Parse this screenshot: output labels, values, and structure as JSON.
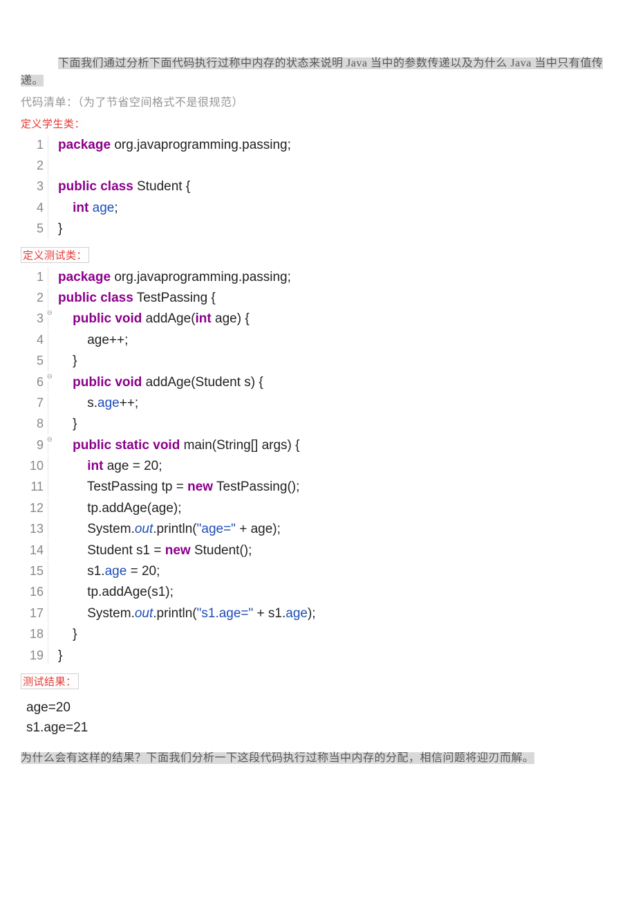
{
  "intro": "下面我们通过分析下面代码执行过称中内存的状态来说明 Java 当中的参数传递以及为什么 Java 当中只有值传递。",
  "note": "代码清单：（为了节省空间格式不是很规范）",
  "label_student": "定义学生类：",
  "label_test": "定义测试类：",
  "label_result": "测试结果：",
  "closing": "为什么会有这样的结果？下面我们分析一下这段代码执行过称当中内存的分配，相信问题将迎刃而解。",
  "student": {
    "l1": {
      "kw": "package",
      "rest": " org.javaprogramming.passing;"
    },
    "l3a": "public class",
    "l3b": " Student {",
    "l4a": "int",
    "l4b": " age",
    "l4c": ";",
    "l5": "}"
  },
  "test": {
    "l1": {
      "kw": "package",
      "rest": " org.javaprogramming.passing;"
    },
    "l2a": "public class",
    "l2b": " TestPassing {",
    "l3a": "public void",
    "l3b": " addAge(",
    "l3c": "int",
    "l3d": " age) {",
    "l4": "age++;",
    "l5": "}",
    "l6a": "public void",
    "l6b": " addAge(Student s) {",
    "l7a": "s.",
    "l7b": "age",
    "l7c": "++;",
    "l8": "}",
    "l9a": "public static void",
    "l9b": " main(String[] args) {",
    "l10a": "int",
    "l10b": " age = 20;",
    "l11a": "TestPassing tp = ",
    "l11b": "new",
    "l11c": " TestPassing();",
    "l12": "tp.addAge(age);",
    "l13a": "System.",
    "l13b": "out",
    "l13c": ".println(",
    "l13d": "\"age=\"",
    "l13e": " + age);",
    "l14a": "Student s1 = ",
    "l14b": "new",
    "l14c": " Student();",
    "l15a": "s1.",
    "l15b": "age",
    "l15c": " = 20;",
    "l16": "tp.addAge(s1);",
    "l17a": "System.",
    "l17b": "out",
    "l17c": ".println(",
    "l17d": "\"s1.age=\"",
    "l17e": " + s1.",
    "l17f": "age",
    "l17g": ");",
    "l18": "}",
    "l19": "}"
  },
  "output": {
    "line1": "age=20",
    "line2": "s1.age=21"
  }
}
